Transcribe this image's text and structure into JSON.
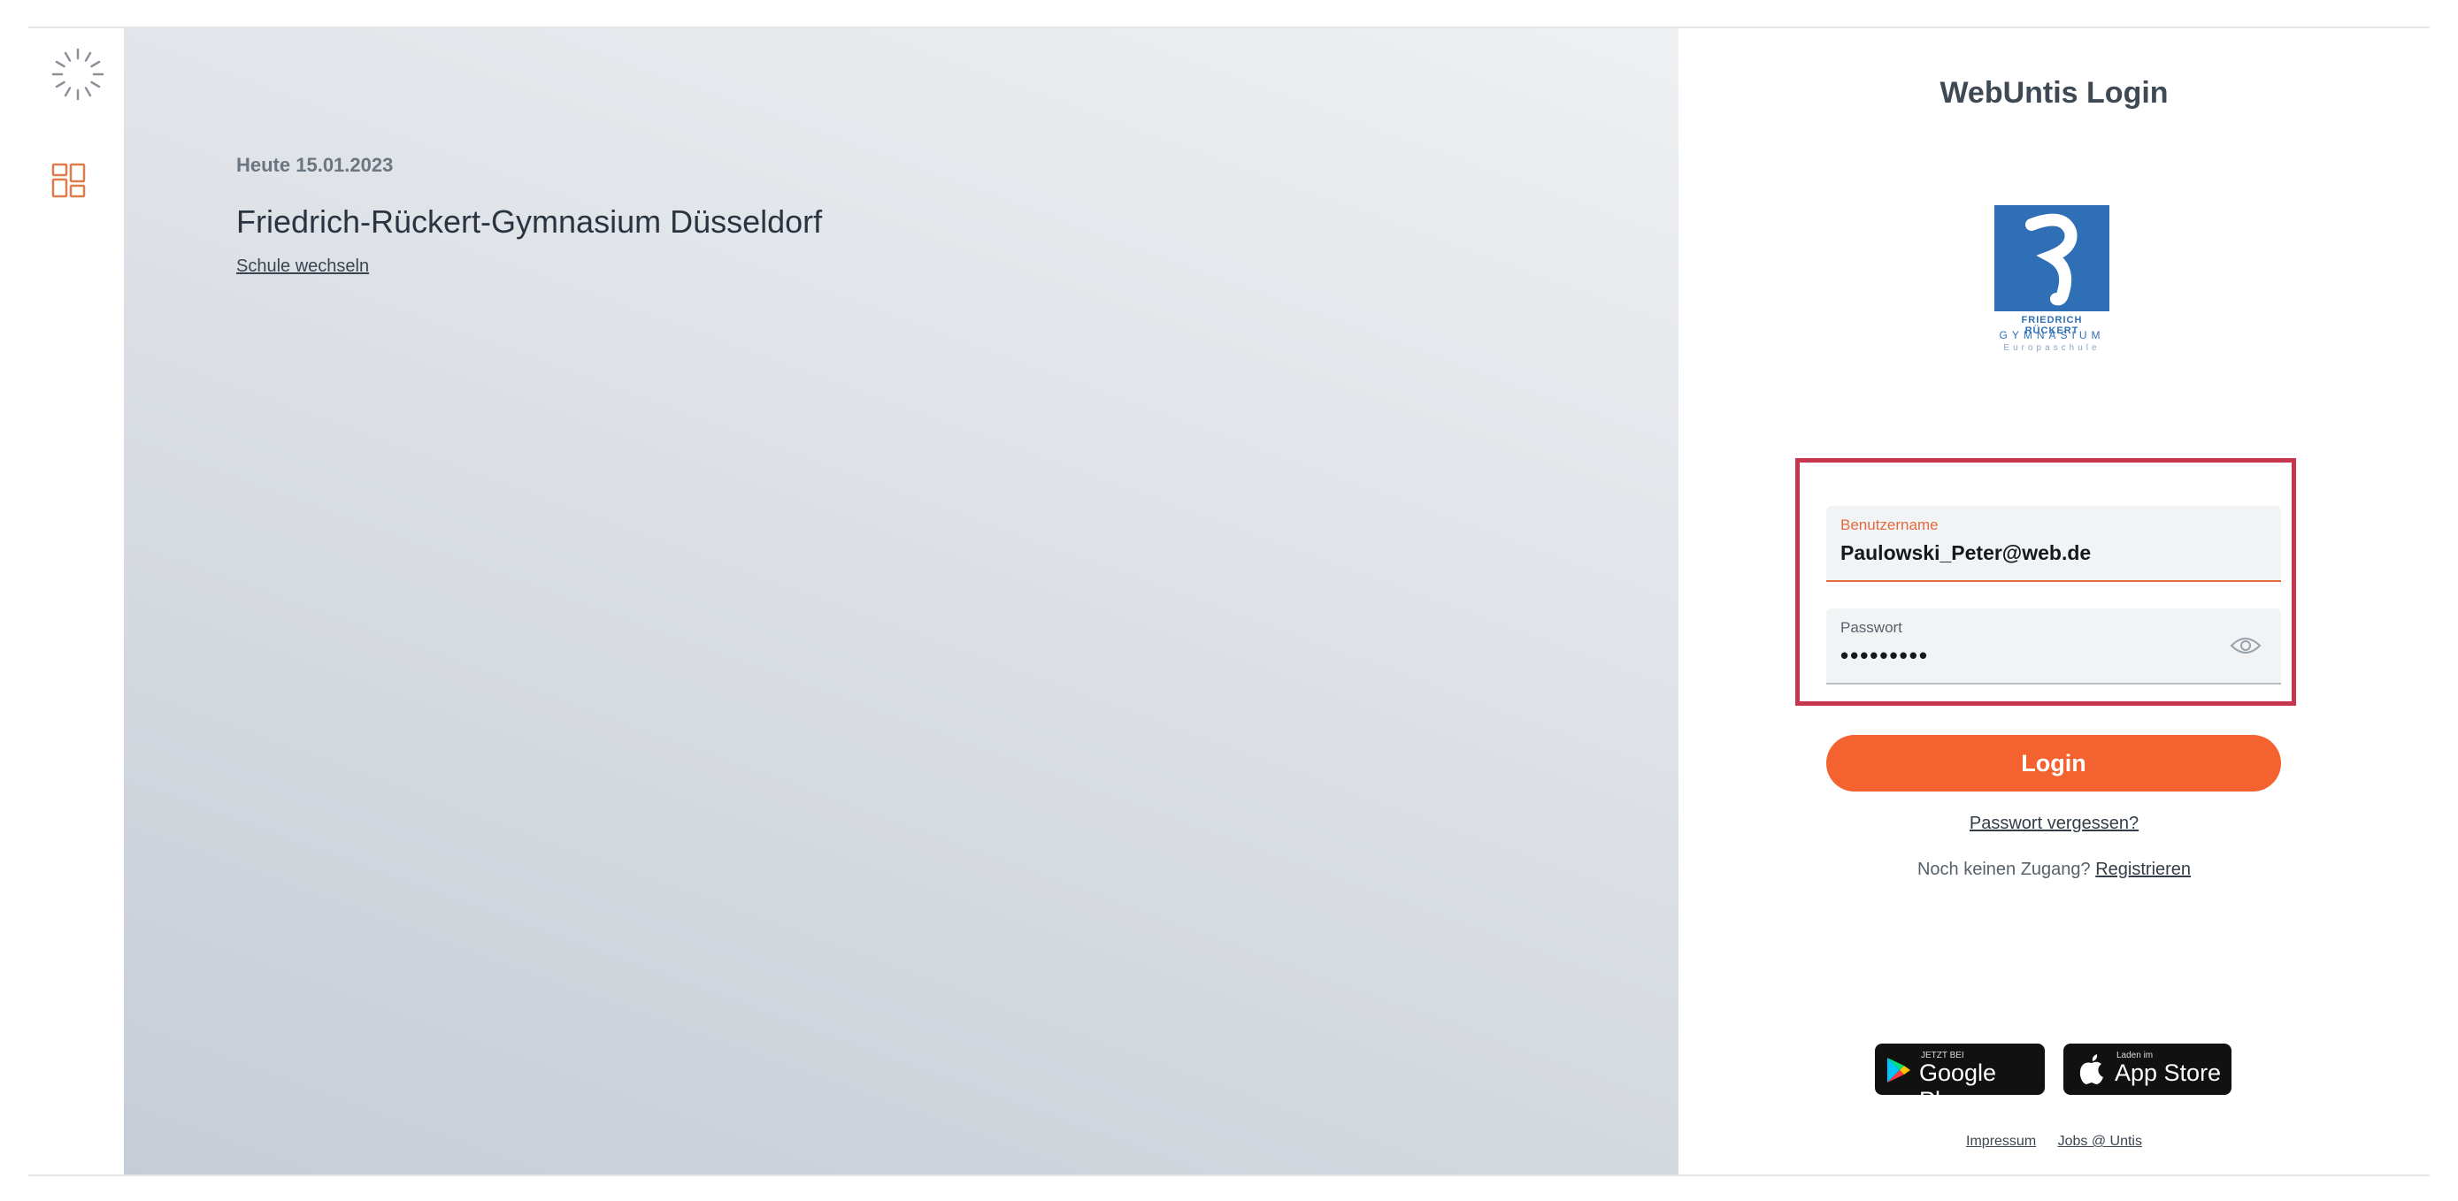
{
  "hero": {
    "date": "Heute 15.01.2023",
    "school_name": "Friedrich-Rückert-Gymnasium Düsseldorf",
    "change_school": "Schule wechseln"
  },
  "login": {
    "title": "WebUntis Login",
    "logo": {
      "line1": "FRIEDRICH RÜCKERT",
      "line2": "GYMNASIUM",
      "line3": "Europaschule"
    },
    "username": {
      "label": "Benutzername",
      "value": "Paulowski_Peter@web.de"
    },
    "password": {
      "label": "Passwort",
      "value": "•••••••••"
    },
    "login_button": "Login",
    "forgot": "Passwort vergessen?",
    "no_access": "Noch keinen Zugang?",
    "register": "Registrieren"
  },
  "stores": {
    "google": {
      "small": "JETZT BEI",
      "big": "Google Play"
    },
    "apple": {
      "small": "Laden im",
      "big": "App Store"
    }
  },
  "footer": {
    "impressum": "Impressum",
    "jobs": "Jobs @ Untis"
  },
  "colors": {
    "accent": "#f4622f",
    "highlight": "#c6364c",
    "logo_blue": "#2f6fb6",
    "dashboard_icon": "#e07b4c"
  },
  "icons": [
    "loading-spinner-icon",
    "dashboard-icon",
    "eye-icon",
    "google-play-icon",
    "apple-icon"
  ]
}
